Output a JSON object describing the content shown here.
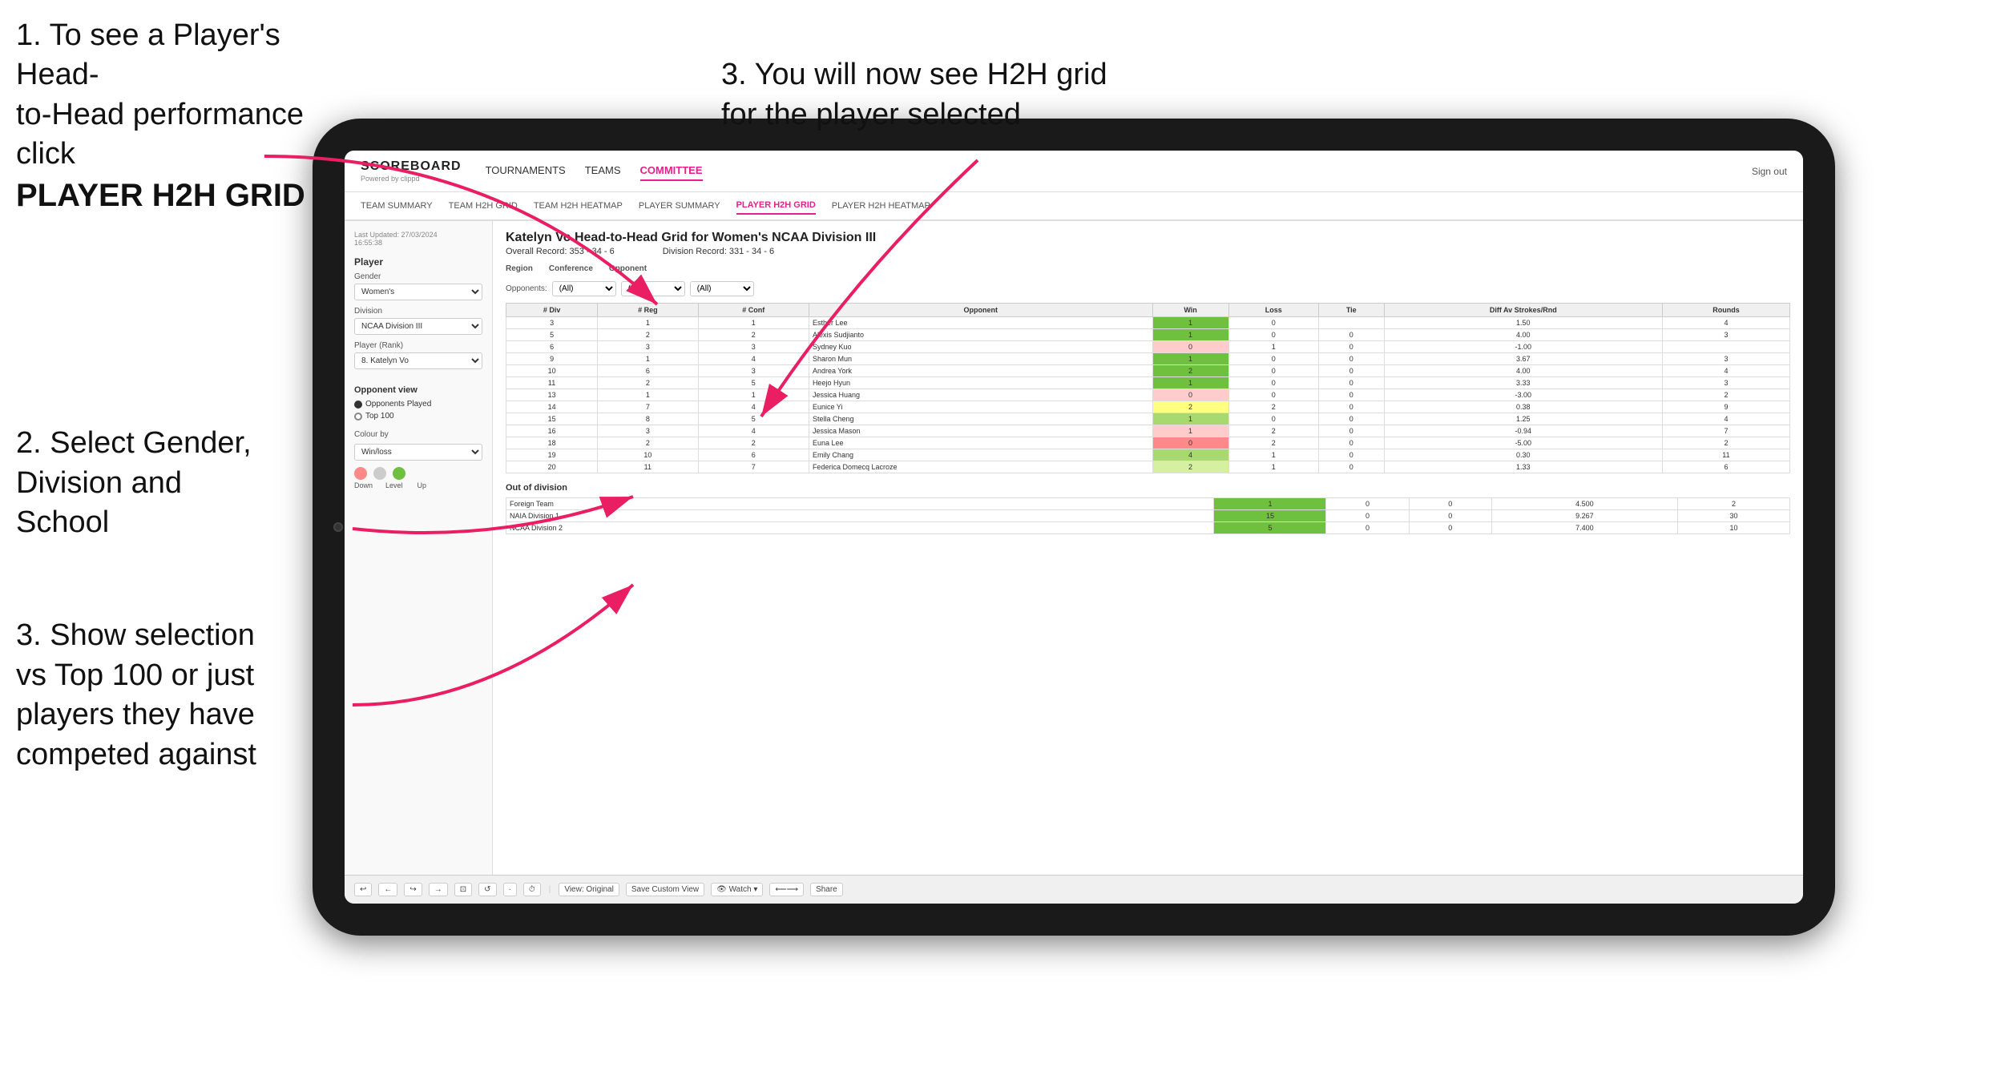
{
  "instructions": {
    "top_left_line1": "1. To see a Player's Head-",
    "top_left_line2": "to-Head performance click",
    "top_left_bold": "PLAYER H2H GRID",
    "top_right": "3. You will now see H2H grid\nfor the player selected",
    "mid_left_title": "2. Select Gender,\nDivision and\nSchool",
    "bottom_left_title": "3. Show selection\nvs Top 100 or just\nplayers they have\ncompeted against"
  },
  "nav": {
    "logo": "SCOREBOARD",
    "logo_sub": "Powered by clippd",
    "items": [
      "TOURNAMENTS",
      "TEAMS",
      "COMMITTEE"
    ],
    "active_item": "COMMITTEE",
    "sign_out": "Sign out"
  },
  "sub_nav": {
    "items": [
      "TEAM SUMMARY",
      "TEAM H2H GRID",
      "TEAM H2H HEATMAP",
      "PLAYER SUMMARY",
      "PLAYER H2H GRID",
      "PLAYER H2H HEATMAP"
    ],
    "active": "PLAYER H2H GRID"
  },
  "sidebar": {
    "timestamp": "Last Updated: 27/03/2024\n16:55:38",
    "player_section": "Player",
    "gender_label": "Gender",
    "gender_value": "Women's",
    "division_label": "Division",
    "division_value": "NCAA Division III",
    "player_rank_label": "Player (Rank)",
    "player_rank_value": "8. Katelyn Vo",
    "opponent_view_title": "Opponent view",
    "radio_options": [
      "Opponents Played",
      "Top 100"
    ],
    "selected_radio": "Opponents Played",
    "colour_by_label": "Colour by",
    "colour_value": "Win/loss",
    "colour_legend": [
      "Down",
      "Level",
      "Up"
    ]
  },
  "main": {
    "title": "Katelyn Vo Head-to-Head Grid for Women's NCAA Division III",
    "overall_record": "Overall Record: 353 - 34 - 6",
    "division_record": "Division Record: 331 - 34 - 6",
    "filters": {
      "region_label": "Region",
      "conference_label": "Conference",
      "opponent_label": "Opponent",
      "opponents_label": "Opponents:",
      "region_value": "(All)",
      "conference_value": "(All)",
      "opponent_value": "(All)"
    },
    "table_headers": [
      "# Div",
      "# Reg",
      "# Conf",
      "Opponent",
      "Win",
      "Loss",
      "Tie",
      "Diff Av Strokes/Rnd",
      "Rounds"
    ],
    "table_rows": [
      {
        "div": "3",
        "reg": "1",
        "conf": "1",
        "opponent": "Esther Lee",
        "win": "1",
        "loss": "0",
        "tie": "",
        "diff": "1.50",
        "rounds": "4",
        "win_color": "green-bright"
      },
      {
        "div": "5",
        "reg": "2",
        "conf": "2",
        "opponent": "Alexis Sudjianto",
        "win": "1",
        "loss": "0",
        "tie": "0",
        "diff": "4.00",
        "rounds": "3",
        "win_color": "green-bright"
      },
      {
        "div": "6",
        "reg": "3",
        "conf": "3",
        "opponent": "Sydney Kuo",
        "win": "0",
        "loss": "1",
        "tie": "0",
        "diff": "-1.00",
        "rounds": "",
        "win_color": "red-light"
      },
      {
        "div": "9",
        "reg": "1",
        "conf": "4",
        "opponent": "Sharon Mun",
        "win": "1",
        "loss": "0",
        "tie": "0",
        "diff": "3.67",
        "rounds": "3",
        "win_color": "green-bright"
      },
      {
        "div": "10",
        "reg": "6",
        "conf": "3",
        "opponent": "Andrea York",
        "win": "2",
        "loss": "0",
        "tie": "0",
        "diff": "4.00",
        "rounds": "4",
        "win_color": "green-bright"
      },
      {
        "div": "11",
        "reg": "2",
        "conf": "5",
        "opponent": "Heejo Hyun",
        "win": "1",
        "loss": "0",
        "tie": "0",
        "diff": "3.33",
        "rounds": "3",
        "win_color": "green-bright"
      },
      {
        "div": "13",
        "reg": "1",
        "conf": "1",
        "opponent": "Jessica Huang",
        "win": "0",
        "loss": "0",
        "tie": "0",
        "diff": "-3.00",
        "rounds": "2",
        "win_color": "red-light"
      },
      {
        "div": "14",
        "reg": "7",
        "conf": "4",
        "opponent": "Eunice Yi",
        "win": "2",
        "loss": "2",
        "tie": "0",
        "diff": "0.38",
        "rounds": "9",
        "win_color": "yellow"
      },
      {
        "div": "15",
        "reg": "8",
        "conf": "5",
        "opponent": "Stella Cheng",
        "win": "1",
        "loss": "0",
        "tie": "0",
        "diff": "1.25",
        "rounds": "4",
        "win_color": "green-mid"
      },
      {
        "div": "16",
        "reg": "3",
        "conf": "4",
        "opponent": "Jessica Mason",
        "win": "1",
        "loss": "2",
        "tie": "0",
        "diff": "-0.94",
        "rounds": "7",
        "win_color": "red-light"
      },
      {
        "div": "18",
        "reg": "2",
        "conf": "2",
        "opponent": "Euna Lee",
        "win": "0",
        "loss": "2",
        "tie": "0",
        "diff": "-5.00",
        "rounds": "2",
        "win_color": "red"
      },
      {
        "div": "19",
        "reg": "10",
        "conf": "6",
        "opponent": "Emily Chang",
        "win": "4",
        "loss": "1",
        "tie": "0",
        "diff": "0.30",
        "rounds": "11",
        "win_color": "green-mid"
      },
      {
        "div": "20",
        "reg": "11",
        "conf": "7",
        "opponent": "Federica Domecq Lacroze",
        "win": "2",
        "loss": "1",
        "tie": "0",
        "diff": "1.33",
        "rounds": "6",
        "win_color": "green-light"
      }
    ],
    "out_of_division_title": "Out of division",
    "ood_rows": [
      {
        "label": "Foreign Team",
        "win": "1",
        "loss": "0",
        "tie": "0",
        "diff": "4.500",
        "rounds": "2"
      },
      {
        "label": "NAIA Division 1",
        "win": "15",
        "loss": "0",
        "tie": "0",
        "diff": "9.267",
        "rounds": "30"
      },
      {
        "label": "NCAA Division 2",
        "win": "5",
        "loss": "0",
        "tie": "0",
        "diff": "7.400",
        "rounds": "10"
      }
    ]
  },
  "toolbar": {
    "buttons": [
      "↩",
      "←",
      "↪",
      "→",
      "⊡",
      "↺",
      "·",
      "⏱",
      "View: Original",
      "Save Custom View",
      "👁 Watch ▾",
      "⊕",
      "⟵⟶",
      "Share"
    ]
  }
}
